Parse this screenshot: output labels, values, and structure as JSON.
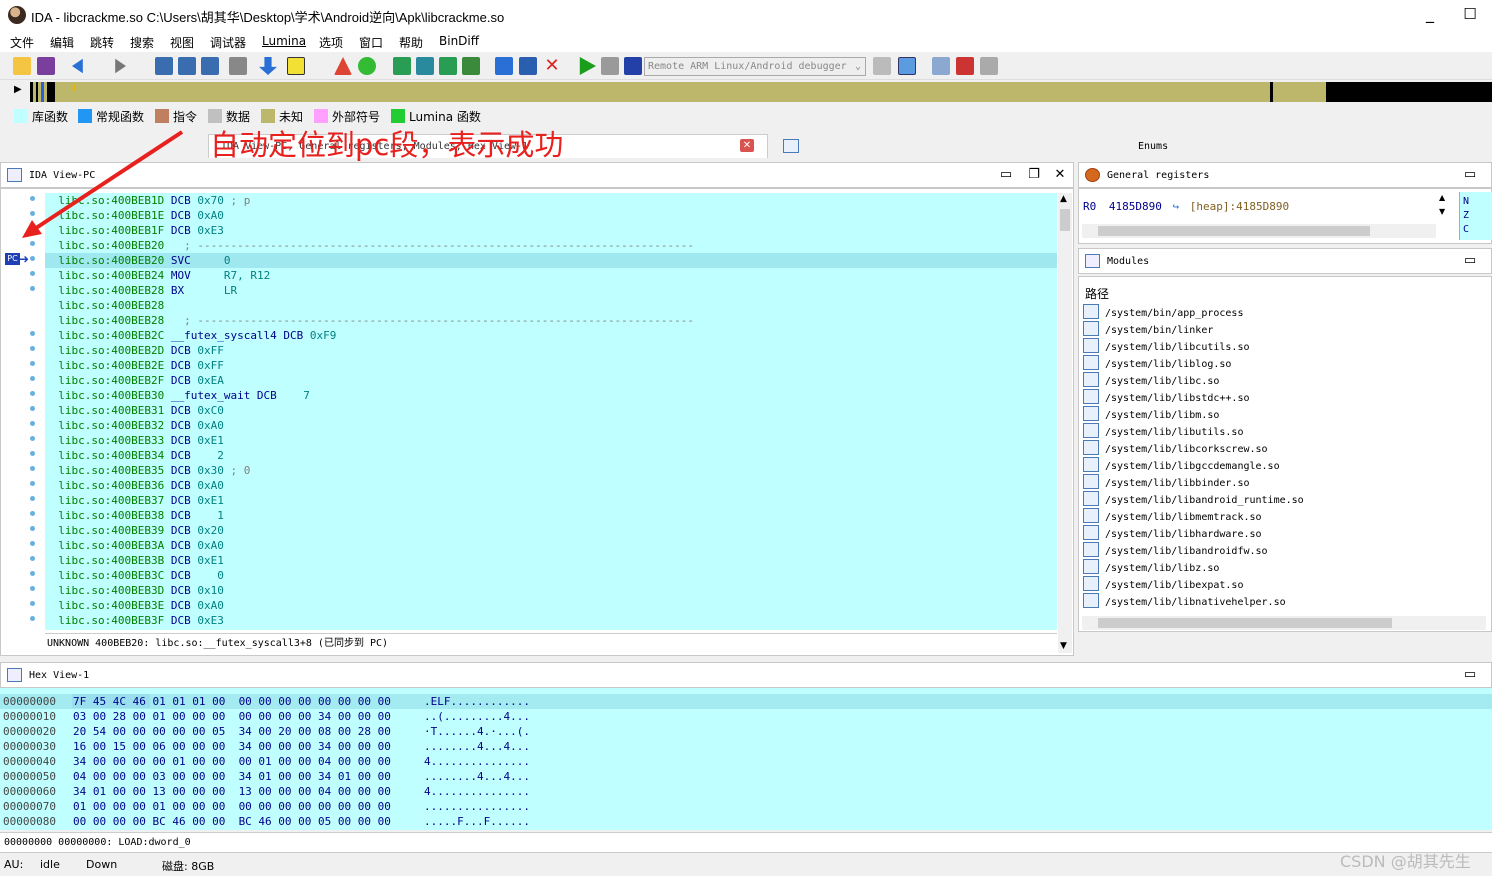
{
  "window": {
    "title": "IDA - libcrackme.so C:\\Users\\胡其华\\Desktop\\学术\\Android逆向\\Apk\\libcrackme.so",
    "minimize": "_",
    "maximize": "☐"
  },
  "menu": [
    "文件",
    "编辑",
    "跳转",
    "搜索",
    "视图",
    "调试器",
    "Lumina",
    "选项",
    "窗口",
    "帮助",
    "BinDiff"
  ],
  "toolbar": {
    "debugger": "Remote ARM Linux/Android debugger"
  },
  "legend": [
    {
      "label": "库函数",
      "color": "#c0ffff"
    },
    {
      "label": "常规函数",
      "color": "#2196f3"
    },
    {
      "label": "指令",
      "color": "#c08060"
    },
    {
      "label": "数据",
      "color": "#c0c0c0"
    },
    {
      "label": "未知",
      "color": "#bdb76b"
    },
    {
      "label": "外部符号",
      "color": "#ffa0ff"
    },
    {
      "label": "Lumina 函数",
      "color": "#22cc33"
    }
  ],
  "tabs": {
    "main": "IDA View-PC, General registers, Modules, Hex View-1",
    "enums": "Enums"
  },
  "annotation": "自动定位到pc段，表示成功",
  "ida_view": {
    "title": "IDA View-PC",
    "pc_label": "PC",
    "lines": [
      {
        "addr": "libc.so:400BEB1D",
        "mn": "DCB",
        "op": "0x70",
        "cm": "; p"
      },
      {
        "addr": "libc.so:400BEB1E",
        "mn": "DCB",
        "op": "0xA0",
        "cm": ""
      },
      {
        "addr": "libc.so:400BEB1F",
        "mn": "DCB",
        "op": "0xE3",
        "cm": ""
      },
      {
        "addr": "libc.so:400BEB20",
        "mn": "",
        "op": "",
        "cm": "; ---------------------------------------------------------------------------"
      },
      {
        "addr": "libc.so:400BEB20",
        "mn": "SVC",
        "op": "    0",
        "cm": "",
        "hl": true
      },
      {
        "addr": "libc.so:400BEB24",
        "mn": "MOV",
        "op": "    R7, R12",
        "cm": ""
      },
      {
        "addr": "libc.so:400BEB28",
        "mn": "BX",
        "op": "     LR",
        "cm": ""
      },
      {
        "addr": "libc.so:400BEB28",
        "mn": "",
        "op": "",
        "cm": ""
      },
      {
        "addr": "libc.so:400BEB28",
        "mn": "",
        "op": "",
        "cm": "; ---------------------------------------------------------------------------"
      },
      {
        "addr": "libc.so:400BEB2C",
        "mn": "__futex_syscall4 DCB",
        "op": "0xF9",
        "cm": ""
      },
      {
        "addr": "libc.so:400BEB2D",
        "mn": "DCB",
        "op": "0xFF",
        "cm": ""
      },
      {
        "addr": "libc.so:400BEB2E",
        "mn": "DCB",
        "op": "0xFF",
        "cm": ""
      },
      {
        "addr": "libc.so:400BEB2F",
        "mn": "DCB",
        "op": "0xEA",
        "cm": ""
      },
      {
        "addr": "libc.so:400BEB30",
        "mn": "__futex_wait DCB",
        "op": "   7",
        "cm": ""
      },
      {
        "addr": "libc.so:400BEB31",
        "mn": "DCB",
        "op": "0xC0",
        "cm": ""
      },
      {
        "addr": "libc.so:400BEB32",
        "mn": "DCB",
        "op": "0xA0",
        "cm": ""
      },
      {
        "addr": "libc.so:400BEB33",
        "mn": "DCB",
        "op": "0xE1",
        "cm": ""
      },
      {
        "addr": "libc.so:400BEB34",
        "mn": "DCB",
        "op": "   2",
        "cm": ""
      },
      {
        "addr": "libc.so:400BEB35",
        "mn": "DCB",
        "op": "0x30",
        "cm": "; 0"
      },
      {
        "addr": "libc.so:400BEB36",
        "mn": "DCB",
        "op": "0xA0",
        "cm": ""
      },
      {
        "addr": "libc.so:400BEB37",
        "mn": "DCB",
        "op": "0xE1",
        "cm": ""
      },
      {
        "addr": "libc.so:400BEB38",
        "mn": "DCB",
        "op": "   1",
        "cm": ""
      },
      {
        "addr": "libc.so:400BEB39",
        "mn": "DCB",
        "op": "0x20",
        "cm": ""
      },
      {
        "addr": "libc.so:400BEB3A",
        "mn": "DCB",
        "op": "0xA0",
        "cm": ""
      },
      {
        "addr": "libc.so:400BEB3B",
        "mn": "DCB",
        "op": "0xE1",
        "cm": ""
      },
      {
        "addr": "libc.so:400BEB3C",
        "mn": "DCB",
        "op": "   0",
        "cm": ""
      },
      {
        "addr": "libc.so:400BEB3D",
        "mn": "DCB",
        "op": "0x10",
        "cm": ""
      },
      {
        "addr": "libc.so:400BEB3E",
        "mn": "DCB",
        "op": "0xA0",
        "cm": ""
      },
      {
        "addr": "libc.so:400BEB3F",
        "mn": "DCB",
        "op": "0xE3",
        "cm": ""
      }
    ],
    "status": "UNKNOWN 400BEB20: libc.so:__futex_syscall3+8 (已同步到 PC)"
  },
  "registers": {
    "title": "General registers",
    "reg": "R0",
    "value": "4185D890",
    "target": "[heap]:4185D890",
    "flags": [
      "N",
      "Z",
      "C"
    ]
  },
  "modules": {
    "title": "Modules",
    "header": "路径",
    "items": [
      "/system/bin/app_process",
      "/system/bin/linker",
      "/system/lib/libcutils.so",
      "/system/lib/liblog.so",
      "/system/lib/libc.so",
      "/system/lib/libstdc++.so",
      "/system/lib/libm.so",
      "/system/lib/libutils.so",
      "/system/lib/libcorkscrew.so",
      "/system/lib/libgccdemangle.so",
      "/system/lib/libbinder.so",
      "/system/lib/libandroid_runtime.so",
      "/system/lib/libmemtrack.so",
      "/system/lib/libhardware.so",
      "/system/lib/libandroidfw.so",
      "/system/lib/libz.so",
      "/system/lib/libexpat.so",
      "/system/lib/libnativehelper.so"
    ]
  },
  "hex_view": {
    "title": "Hex View-1",
    "rows": [
      {
        "addr": "00000000",
        "bytes": "7F 45 4C 46 01 01 01 00  00 00 00 00 00 00 00 00",
        "ascii": ".ELF............"
      },
      {
        "addr": "00000010",
        "bytes": "03 00 28 00 01 00 00 00  00 00 00 00 34 00 00 00",
        "ascii": "..(.........4..."
      },
      {
        "addr": "00000020",
        "bytes": "20 54 00 00 00 00 00 05  34 00 20 00 08 00 28 00",
        "ascii": "·T......4.·...(."
      },
      {
        "addr": "00000030",
        "bytes": "16 00 15 00 06 00 00 00  34 00 00 00 34 00 00 00",
        "ascii": "........4...4..."
      },
      {
        "addr": "00000040",
        "bytes": "34 00 00 00 00 01 00 00  00 01 00 00 04 00 00 00",
        "ascii": "4..............."
      },
      {
        "addr": "00000050",
        "bytes": "04 00 00 00 03 00 00 00  34 01 00 00 34 01 00 00",
        "ascii": "........4...4..."
      },
      {
        "addr": "00000060",
        "bytes": "34 01 00 00 13 00 00 00  13 00 00 00 04 00 00 00",
        "ascii": "4..............."
      },
      {
        "addr": "00000070",
        "bytes": "01 00 00 00 01 00 00 00  00 00 00 00 00 00 00 00",
        "ascii": "................"
      },
      {
        "addr": "00000080",
        "bytes": "00 00 00 00 BC 46 00 00  BC 46 00 00 05 00 00 00",
        "ascii": ".....F...F......"
      }
    ],
    "status": "00000000 00000000: LOAD:dword_0"
  },
  "statusbar": {
    "au": "AU:",
    "state": "idle",
    "dir": "Down",
    "disk": "磁盘: 8GB"
  },
  "watermark": "CSDN @胡其先生"
}
